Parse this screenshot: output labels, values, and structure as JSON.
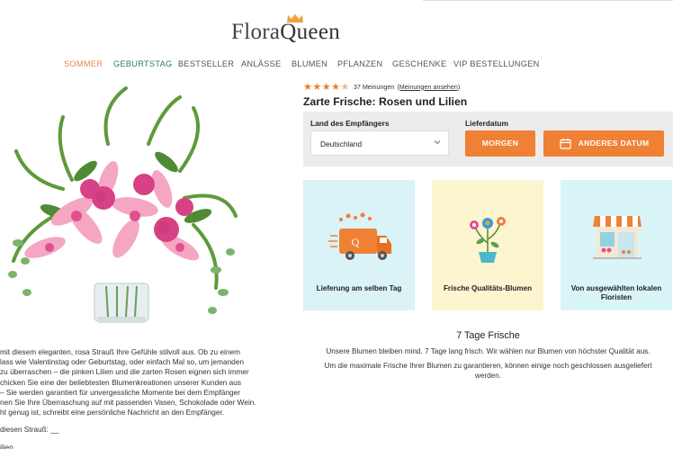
{
  "header": {
    "logo_part1": "Flora",
    "logo_part2": "Queen"
  },
  "nav": [
    {
      "label": "SOMMER",
      "color": "#e9844a"
    },
    {
      "label": "GEBURTSTAG",
      "color": "#2a7b72"
    },
    {
      "label": "BESTSELLER",
      "color": "#555555"
    },
    {
      "label": "ANLÄSSE",
      "color": "#555555"
    },
    {
      "label": "BLUMEN",
      "color": "#555555"
    },
    {
      "label": "PFLANZEN",
      "color": "#555555"
    },
    {
      "label": "GESCHENKE",
      "color": "#555555"
    },
    {
      "label": "VIP BESTELLUNGEN",
      "color": "#555555"
    }
  ],
  "product": {
    "rating_stars": 4.5,
    "reviews_count": "37 Meinungen",
    "reviews_link": "(Meinungen ansehen)",
    "title": "Zarte Frische: Rosen und Lilien"
  },
  "form": {
    "country_label": "Land des Empfängers",
    "country_value": "Deutschland",
    "date_label": "Lieferdatum",
    "tomorrow_button": "MORGEN",
    "other_date_button": "ANDERES DATUM"
  },
  "features": [
    {
      "caption": "Lieferung am selben Tag",
      "bg": "#d9f3f6"
    },
    {
      "caption": "Frische Qualitäts-Blumen",
      "bg": "#fcf5d0"
    },
    {
      "caption": "Von ausgewählten lokalen Floristen",
      "bg": "#d9f5f8"
    }
  ],
  "freshness": {
    "title": "7 Tage Frische",
    "line1": "Unsere Blumen bleiben mind. 7 Tage lang frisch. Wir wählen nur Blumen von höchster Qualität aus.",
    "line2": "Um die maximale Frische Ihrer Blumen zu garantieren, können einige noch geschlossen ausgeliefert",
    "line3": "werden."
  },
  "description": {
    "lines": [
      "mit diesem eleganten, rosa Strauß Ihre Gefühle stilvoll aus. Ob zu einem",
      "lass wie Valentinstag oder Geburtstag, oder einfach Mal so, um jemanden",
      "zu überraschen – die pinken Lilien und die zarten Rosen eignen sich immer",
      "chicken Sie eine der beliebtesten Blumenkreationen unserer Kunden aus",
      "– Sie werden garantiert für unvergessliche Momente bei dem Empfänger",
      "nen Sie Ihre Überraschung auf mit passenden Vasen, Schokolade oder Wein.",
      "ht genug ist, schreibt eine persönliche Nachricht an den Empfänger."
    ],
    "bouquet_line": "diesen Strauß: __",
    "last_line": "ilien"
  },
  "colors": {
    "accent": "#f08034",
    "star": "#f07b22",
    "panel": "#ececec"
  }
}
